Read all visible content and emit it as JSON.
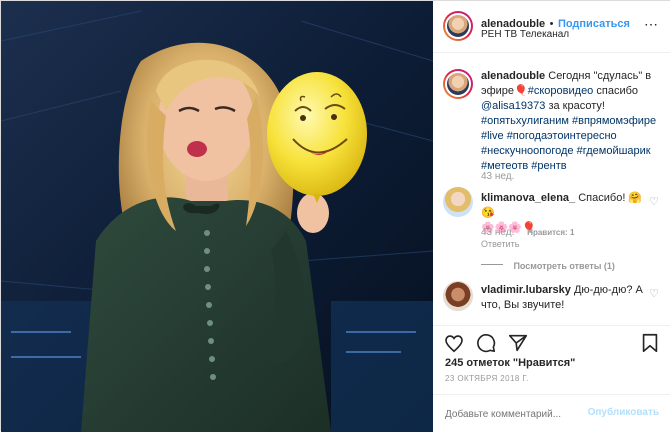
{
  "header": {
    "username": "alenadouble",
    "dot": "•",
    "follow": "Подписаться",
    "location": "РЕН ТВ Телеканал"
  },
  "caption": {
    "username": "alenadouble",
    "text": "Сегодня \"сдулась\" в эфире🎈",
    "tag_soon": "#скоровидео",
    "text2": " спасибо",
    "mention": "@alisa19373",
    "text3": " за красоту!",
    "hashtags": [
      "#опятьхулиганим",
      "#впрямомэфире",
      "#live",
      "#погодаэтоинтересно",
      "#нескучноопогоде",
      "#гдемойшарик",
      "#метеотв",
      "#рентв"
    ],
    "time": "43 нед."
  },
  "comments": [
    {
      "username": "klimanova_elena_",
      "text": "Спасибо! 🤗😘",
      "text_line2": "🌸🌸🌸🎈",
      "time": "43 нед.",
      "likes": "Нравится: 1",
      "reply": "Ответить",
      "view_replies": "Посмотреть ответы (1)"
    },
    {
      "username": "vladimir.lubarsky",
      "text": "Дю-дю-дю? А что, Вы звучите!"
    }
  ],
  "actions": {
    "likes_count": "245 отметок \"Нравится\"",
    "date": "23 ОКТЯБРЯ 2018 Г."
  },
  "add_comment": {
    "placeholder": "Добавьте комментарий...",
    "publish": "Опубликовать"
  },
  "colors": {
    "link_blue": "#3897f0",
    "hashtag": "#003569",
    "muted": "#999999",
    "publish_disabled": "#b2dffc"
  }
}
